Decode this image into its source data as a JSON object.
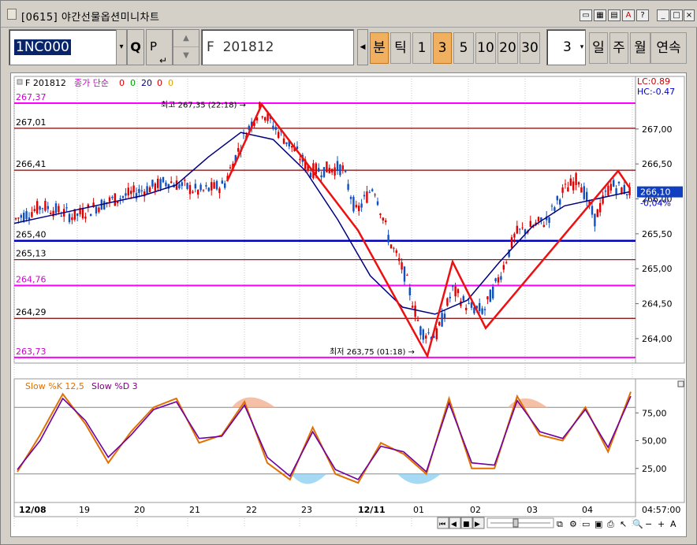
{
  "window": {
    "title": "[0615] 야간선물옵션미니차트"
  },
  "toolbar": {
    "code_value": "1NC000",
    "code_btn_glyph": "▾",
    "search_glyph": "Q",
    "p_label": "P",
    "contract_name": "F  201812",
    "period_buttons": [
      "분",
      "틱",
      "1",
      "3",
      "5",
      "10",
      "20",
      "30"
    ],
    "period_active": [
      "분",
      "3"
    ],
    "interval_value": "3",
    "unit_buttons": [
      "일",
      "주",
      "월",
      "연속"
    ]
  },
  "chart": {
    "legend_code": "F 201812",
    "legend_type": "종가 단순",
    "legend_mas": [
      "0",
      "0",
      "20",
      "0",
      "0"
    ],
    "lc_label": "LC:0.89",
    "hc_label": "HC:-0.47",
    "current_price": "266,10",
    "current_change": "-0,04%",
    "high_note": "최고 267,35 (22:18) →",
    "low_note": "최저 263,75 (01:18) →",
    "price_axis_labels": [
      "267,00",
      "266,50",
      "266,00",
      "265,50",
      "265,00",
      "264,50",
      "264,00"
    ],
    "hlines": [
      {
        "label": "267,37",
        "color": "#ff00ff"
      },
      {
        "label": "267,01",
        "color": "#800000"
      },
      {
        "label": "266,41",
        "color": "#800000"
      },
      {
        "label": "265,40",
        "color": "#0000cc"
      },
      {
        "label": "265,13",
        "color": "#800000"
      },
      {
        "label": "264,76",
        "color": "#ff00ff"
      },
      {
        "label": "264,29",
        "color": "#800000"
      },
      {
        "label": "263,73",
        "color": "#ff00ff"
      }
    ],
    "stoch_legend_k": "Slow %K 12,5",
    "stoch_legend_d": "Slow %D 3",
    "stoch_axis_labels": [
      "75,00",
      "50,00",
      "25,00"
    ],
    "date_labels": [
      "12/08",
      "19",
      "20",
      "21",
      "22",
      "23",
      "12/11",
      "01",
      "02",
      "03",
      "04"
    ],
    "time_label": "04:57:00"
  },
  "chart_data": {
    "type": "candlestick",
    "price_levels": [
      267.37,
      267.01,
      266.41,
      265.4,
      265.13,
      264.76,
      264.29,
      263.73
    ],
    "high": 267.35,
    "low": 263.75,
    "current": 266.1,
    "zigzag": [
      265.6,
      265.8,
      266.25,
      267.35,
      266.45,
      263.75,
      265.1,
      264.15,
      266.4,
      266.1
    ],
    "ma20": [
      265.65,
      265.75,
      265.85,
      265.95,
      266.05,
      266.2,
      266.6,
      266.95,
      266.85,
      266.4,
      265.7,
      264.9,
      264.45,
      264.35,
      264.55,
      265.1,
      265.6,
      265.9,
      266.0,
      266.1
    ],
    "stoch_k": [
      22,
      55,
      92,
      65,
      30,
      58,
      80,
      88,
      48,
      55,
      85,
      30,
      15,
      62,
      20,
      12,
      48,
      38,
      20,
      88,
      25,
      25,
      90,
      55,
      50,
      80,
      40,
      94
    ],
    "stoch_d": [
      24,
      50,
      88,
      68,
      35,
      55,
      78,
      85,
      52,
      54,
      82,
      35,
      18,
      58,
      24,
      15,
      45,
      40,
      22,
      84,
      30,
      28,
      86,
      58,
      52,
      78,
      44,
      90
    ]
  }
}
